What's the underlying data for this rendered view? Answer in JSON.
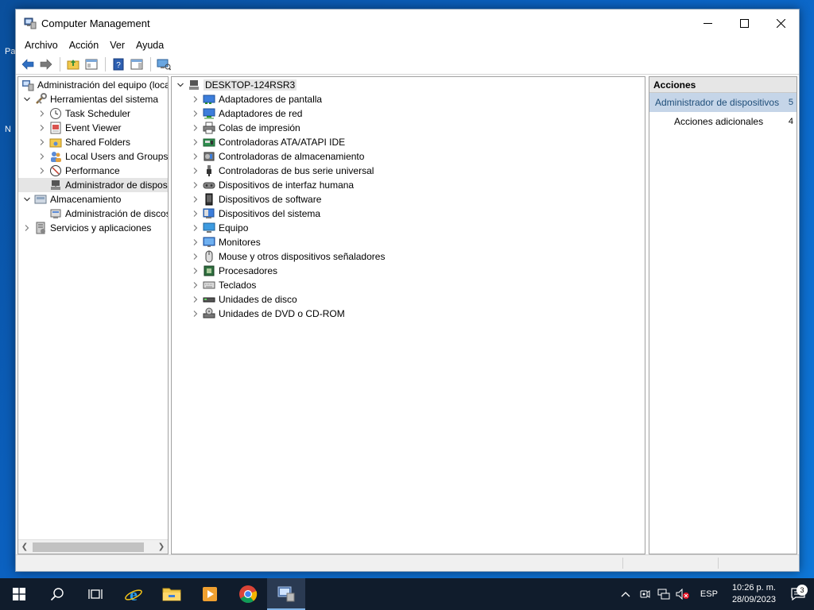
{
  "window": {
    "title": "Computer Management",
    "minimize_label": "Minimize",
    "maximize_label": "Maximize",
    "close_label": "Close"
  },
  "menubar": {
    "items": [
      "Archivo",
      "Acción",
      "Ver",
      "Ayuda"
    ]
  },
  "desktop_edge": [
    "Pa",
    "N"
  ],
  "left_tree": {
    "root": "Administración del equipo (local)",
    "system_tools": "Herramientas del sistema",
    "task_scheduler": "Task Scheduler",
    "event_viewer": "Event Viewer",
    "shared_folders": "Shared Folders",
    "local_users": "Local Users and Groups",
    "performance": "Performance",
    "device_manager": "Administrador de dispositivos",
    "storage": "Almacenamiento",
    "disk_management": "Administración de discos",
    "services": "Servicios y aplicaciones"
  },
  "device_tree": {
    "computer": "DESKTOP-124RSR3",
    "categories": [
      {
        "label": "Adaptadores de pantalla",
        "icon": "display-adapter-icon"
      },
      {
        "label": "Adaptadores de red",
        "icon": "network-adapter-icon"
      },
      {
        "label": "Colas de impresión",
        "icon": "printer-icon"
      },
      {
        "label": "Controladoras ATA/ATAPI IDE",
        "icon": "ide-controller-icon"
      },
      {
        "label": "Controladoras de almacenamiento",
        "icon": "storage-controller-icon"
      },
      {
        "label": "Controladoras de bus serie universal",
        "icon": "usb-icon"
      },
      {
        "label": "Dispositivos de interfaz humana",
        "icon": "hid-icon"
      },
      {
        "label": "Dispositivos de software",
        "icon": "software-device-icon"
      },
      {
        "label": "Dispositivos del sistema",
        "icon": "system-device-icon"
      },
      {
        "label": "Equipo",
        "icon": "computer-icon"
      },
      {
        "label": "Monitores",
        "icon": "monitor-icon"
      },
      {
        "label": "Mouse y otros dispositivos señaladores",
        "icon": "mouse-icon"
      },
      {
        "label": "Procesadores",
        "icon": "processor-icon"
      },
      {
        "label": "Teclados",
        "icon": "keyboard-icon"
      },
      {
        "label": "Unidades de disco",
        "icon": "disk-drive-icon"
      },
      {
        "label": "Unidades de DVD o CD-ROM",
        "icon": "dvd-drive-icon"
      }
    ]
  },
  "actions": {
    "header": "Acciones",
    "selected_label": "Administrador de dispositivos",
    "selected_count": "5",
    "more_label": "Acciones adicionales",
    "more_count": "4"
  },
  "taskbar": {
    "language": "ESP",
    "time": "10:26 p. m.",
    "date": "28/09/2023",
    "notification_count": "3"
  },
  "colors": {
    "selection": "#c5d5e8",
    "taskbar": "#101c2c",
    "desktop": "#0b63c4"
  }
}
